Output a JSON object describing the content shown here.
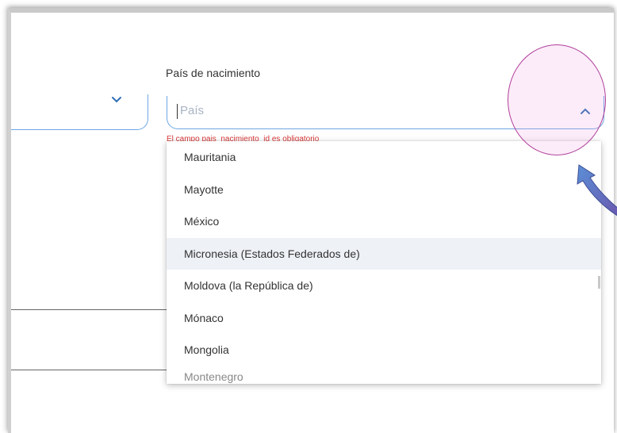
{
  "form": {
    "field_label": "País de nacimiento",
    "country_placeholder": "País",
    "error_message": "El campo pais_nacimiento_id es obligatorio"
  },
  "dropdown": {
    "options": [
      "Mauritania",
      "Mayotte",
      "México",
      "Micronesia (Estados Federados de)",
      "Moldova (la República de)",
      "Mónaco",
      "Mongolia",
      "Montenegro"
    ],
    "highlighted_option": "Micronesia (Estados Federados de)"
  },
  "icons": {
    "left_select": "chevron-down-icon",
    "country_select": "chevron-up-icon",
    "annotation_arrow": "curved-arrow-icon"
  },
  "colors": {
    "accent_border": "#6ea6e3",
    "error": "#d93a3a",
    "highlight_row": "#eef1f6",
    "annotation_circle": "#b03e9a",
    "annotation_arrow": "#7b6bbf"
  }
}
